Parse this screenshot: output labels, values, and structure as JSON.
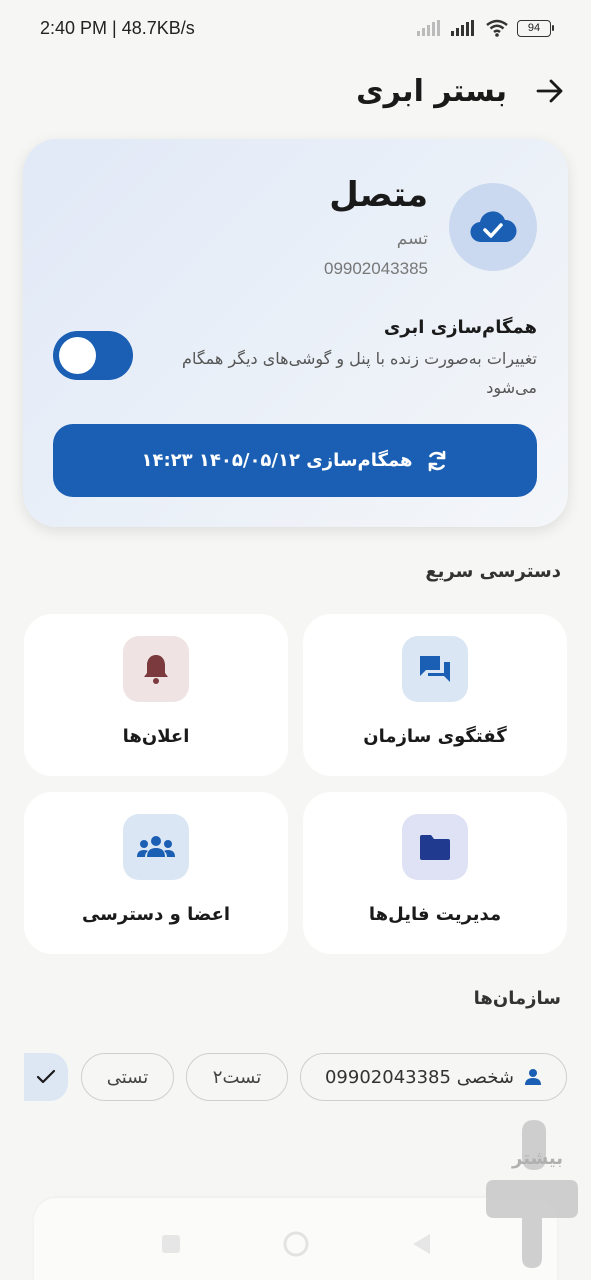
{
  "status_bar": {
    "time": "2:40 PM | 48.7KB/s",
    "battery": "94"
  },
  "header": {
    "title": "بستر ابری",
    "back_icon": "arrow-right-icon"
  },
  "connection": {
    "status": "متصل",
    "name": "تسم",
    "phone": "09902043385",
    "icon": "cloud-check-icon",
    "accent": "#1a5fb4"
  },
  "cloud_sync": {
    "title": "همگام‌سازی ابری",
    "description": "تغییرات به‌صورت زنده با پنل و گوشی‌های دیگر همگام می‌شود",
    "enabled": true,
    "button_label": "همگام‌سازی ۱۴۰۵/۰۵/۱۲ ۱۴:۲۳",
    "button_icon": "sync-icon"
  },
  "quick_access": {
    "title": "دسترسی سریع",
    "items": [
      {
        "label": "گفتگوی سازمان",
        "icon": "chat-icon"
      },
      {
        "label": "اعلان‌ها",
        "icon": "bell-icon"
      },
      {
        "label": "مدیریت فایل‌ها",
        "icon": "folder-icon"
      },
      {
        "label": "اعضا و دسترسی",
        "icon": "group-icon"
      }
    ]
  },
  "organizations": {
    "title": "سازمان‌ها",
    "chips": [
      {
        "label": "شخصی 09902043385",
        "icon": "person-icon"
      },
      {
        "label": "تست۲"
      },
      {
        "label": "تستی"
      }
    ],
    "selected_icon": "check-icon"
  },
  "watermark": {
    "text": "بیشتر"
  }
}
